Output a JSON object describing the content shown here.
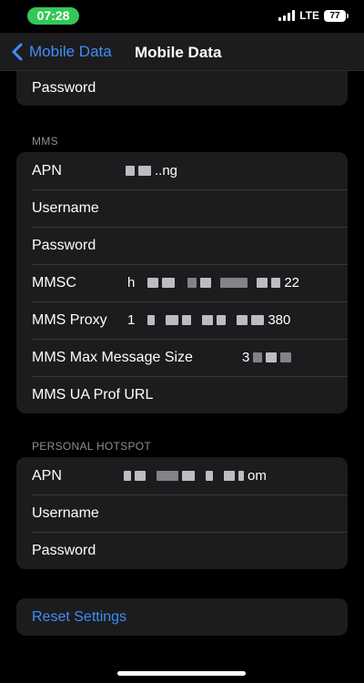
{
  "status_bar": {
    "time": "07:28",
    "network": "LTE",
    "battery": "77"
  },
  "nav": {
    "back_label": "Mobile Data",
    "title": "Mobile Data"
  },
  "top_group": {
    "password_label": "Password"
  },
  "mms": {
    "header": "MMS",
    "rows": {
      "apn": {
        "label": "APN",
        "value": "..ng"
      },
      "username": {
        "label": "Username"
      },
      "password": {
        "label": "Password"
      },
      "mmsc": {
        "label": "MMSC",
        "value_prefix": "h",
        "value_suffix": "22"
      },
      "proxy": {
        "label": "MMS Proxy",
        "value_prefix": "1",
        "value_suffix": "380"
      },
      "max_size": {
        "label": "MMS Max Message Size",
        "value_prefix": "3"
      },
      "ua_prof": {
        "label": "MMS UA Prof URL"
      }
    }
  },
  "hotspot": {
    "header": "PERSONAL HOTSPOT",
    "rows": {
      "apn": {
        "label": "APN",
        "value_suffix": "om"
      },
      "username": {
        "label": "Username"
      },
      "password": {
        "label": "Password"
      }
    }
  },
  "reset": {
    "label": "Reset Settings"
  },
  "colors": {
    "accent": "#3f8ef7",
    "time_pill": "#34c759",
    "group_bg": "#1c1c1e",
    "header_text": "#8e8e93"
  }
}
